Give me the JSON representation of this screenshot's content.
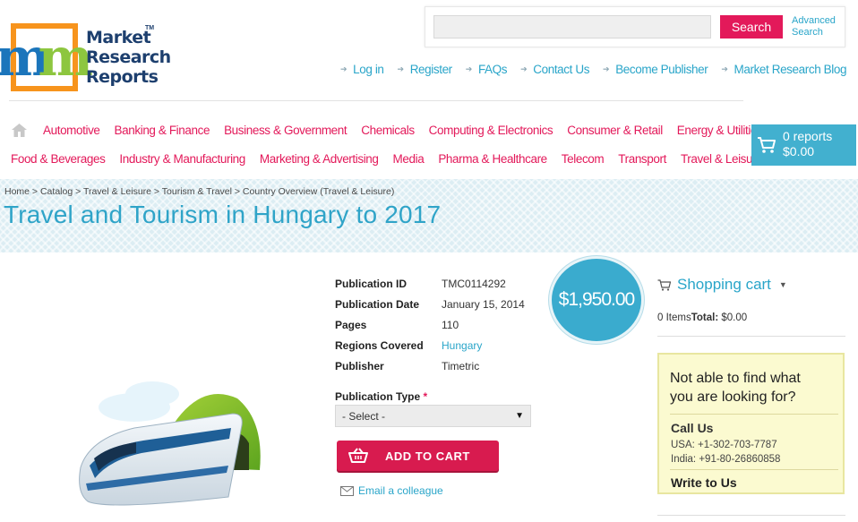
{
  "logo": {
    "lines": [
      "Market",
      "Research",
      "Reports"
    ],
    "tm": "TM"
  },
  "search": {
    "placeholder": "",
    "button_label": "Search",
    "advanced_line1": "Advanced",
    "advanced_line2": "Search"
  },
  "top_links": [
    "Log in",
    "Register",
    "FAQs",
    "Contact Us",
    "Become Publisher",
    "Market Research Blog"
  ],
  "categories_row1": [
    "Automotive",
    "Banking & Finance",
    "Business & Government",
    "Chemicals",
    "Computing & Electronics",
    "Consumer & Retail",
    "Energy & Utilities"
  ],
  "categories_row2": [
    "Food & Beverages",
    "Industry & Manufacturing",
    "Marketing & Advertising",
    "Media",
    "Pharma & Healthcare",
    "Telecom",
    "Transport",
    "Travel & Leisure"
  ],
  "cart": {
    "reports": "0 reports",
    "amount": "$0.00"
  },
  "breadcrumb": "Home > Catalog > Travel & Leisure > Tourism & Travel > Country Overview (Travel & Leisure)",
  "title": "Travel and Tourism in Hungary to 2017",
  "details": {
    "id_label": "Publication ID",
    "id_value": "TMC0114292",
    "date_label": "Publication Date",
    "date_value": "January 15, 2014",
    "pages_label": "Pages",
    "pages_value": "110",
    "regions_label": "Regions Covered",
    "regions_value": "Hungary",
    "publisher_label": "Publisher",
    "publisher_value": "Timetric"
  },
  "price": "$1,950.00",
  "publication_type": {
    "label": "Publication Type",
    "required": "*",
    "selected": "- Select -"
  },
  "add_to_cart": "ADD TO CART",
  "email_colleague": "Email a colleague",
  "shopping_cart": {
    "title": "Shopping cart",
    "items": "0 Items",
    "total_label": "Total:",
    "total_value": "$0.00"
  },
  "help": {
    "question_line1": "Not able to find what",
    "question_line2": "you are looking for?",
    "call_us": "Call Us",
    "usa": "USA: +1-302-703-7787",
    "india": "India: +91-80-26860858",
    "write_us": "Write to Us"
  },
  "colors": {
    "accent": "#29a5c9",
    "brand_pink": "#e3195a",
    "cart_bg": "#42b0cf",
    "add_cart": "#d81b4f"
  }
}
